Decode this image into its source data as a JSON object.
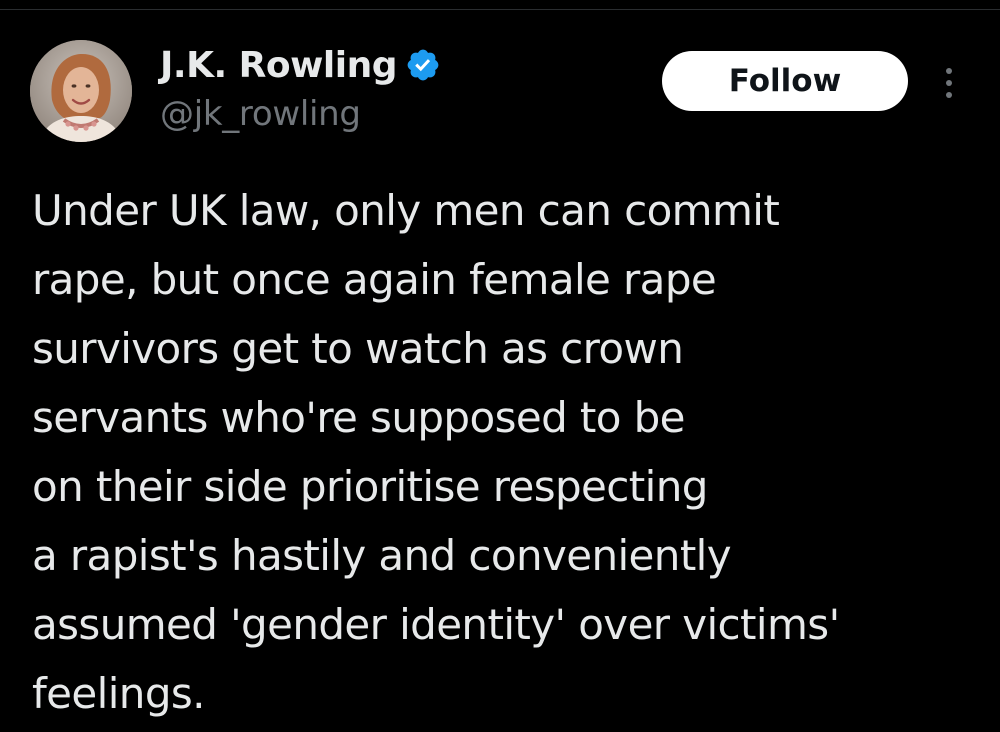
{
  "tweet": {
    "author": {
      "display_name": "J.K. Rowling",
      "handle": "@jk_rowling",
      "verified": true,
      "avatar_icon": "profile-photo"
    },
    "follow_label": "Follow",
    "more_icon": "more-options-icon",
    "text_lines": [
      "Under UK law, only men can commit",
      "rape, but once again female rape",
      "survivors get to watch as crown",
      "servants who're supposed to be",
      "on their side prioritise respecting",
      "a rapist's hastily and conveniently",
      "assumed 'gender identity' over victims'",
      "feelings."
    ]
  },
  "colors": {
    "background": "#000000",
    "primary_text": "#e7e9ea",
    "secondary_text": "#71767b",
    "verified_badge": "#1d9bf0",
    "follow_bg": "#ffffff",
    "follow_text": "#0f1419"
  }
}
